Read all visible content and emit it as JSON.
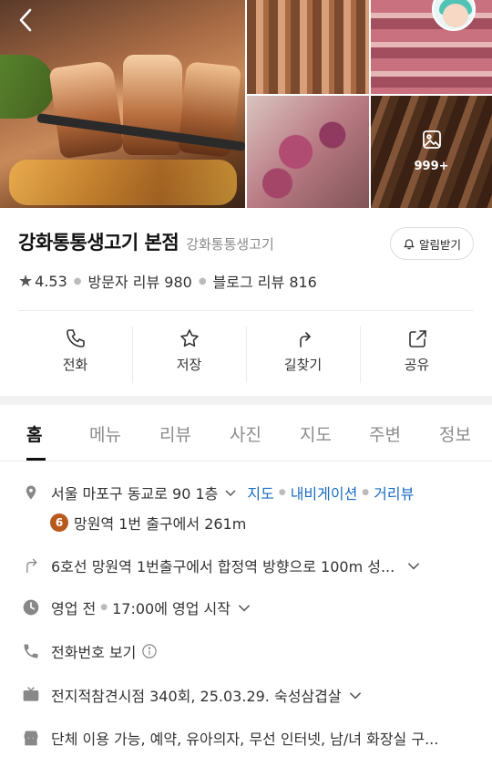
{
  "photos": {
    "more_count": "999+"
  },
  "place": {
    "name": "강화통통생고기 본점",
    "category": "강화통통생고기",
    "alarm_label": "알림받기",
    "rating": "4.53",
    "visitor_reviews": "방문자 리뷰 980",
    "blog_reviews": "블로그 리뷰 816"
  },
  "actions": [
    {
      "label": "전화",
      "icon": "phone-icon"
    },
    {
      "label": "저장",
      "icon": "star-icon"
    },
    {
      "label": "길찾기",
      "icon": "directions-icon"
    },
    {
      "label": "공유",
      "icon": "share-icon"
    }
  ],
  "tabs": [
    "홈",
    "메뉴",
    "리뷰",
    "사진",
    "지도",
    "주변",
    "정보"
  ],
  "info": {
    "address": "서울 마포구 동교로 90 1층",
    "map_link": "지도",
    "navi_link": "내비게이션",
    "street_link": "거리뷰",
    "subway_line": "6",
    "subway_text": "망원역 1번 출구에서 261m",
    "directions_text": "6호선 망원역 1번출구에서 합정역 방향으로 100m 성...",
    "hours_status": "영업 전",
    "hours_text": "17:00에 영업 시작",
    "phone_text": "전화번호 보기",
    "tv_text": "전지적참견시점 340회, 25.03.29. 숙성삼겹살",
    "facilities_text": "단체 이용 가능, 예약, 유아의자, 무선 인터넷, 남/녀 화장실 구..."
  },
  "colors": {
    "link": "#1a6dc2",
    "subway_line6": "#b85a1d"
  }
}
